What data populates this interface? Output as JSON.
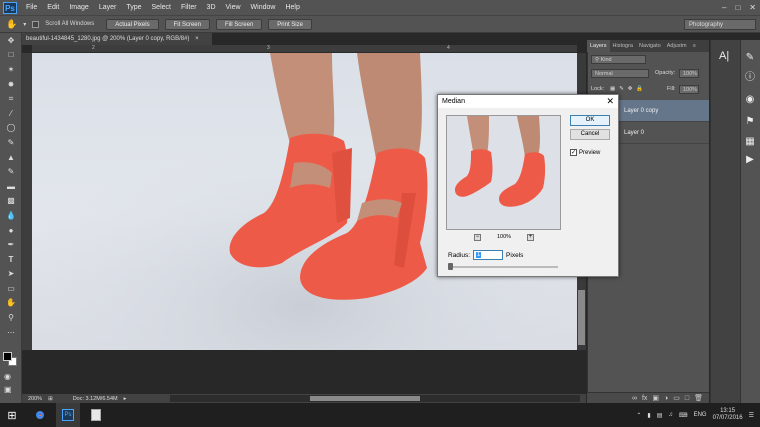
{
  "menubar": {
    "logo": "Ps",
    "items": [
      "File",
      "Edit",
      "Image",
      "Layer",
      "Type",
      "Select",
      "Filter",
      "3D",
      "View",
      "Window",
      "Help"
    ]
  },
  "options": {
    "scroll_all_label": "Scroll All Windows",
    "buttons": [
      "Actual Pixels",
      "Fit Screen",
      "Fill Screen",
      "Print Size"
    ],
    "workspace": "Photography"
  },
  "document": {
    "tab_title": "beautiful-1434845_1280.jpg @ 200% (Layer 0 copy, RGB/8#)",
    "ruler_marks": [
      "0",
      "2",
      "3",
      "4"
    ],
    "zoom": "200%",
    "doc_size": "Doc: 3.12M/6.54M"
  },
  "panels": {
    "tabs": [
      "Layers",
      "Histogra",
      "Navigato",
      "Adjustm"
    ],
    "kind_label": "Kind",
    "blend_mode": "Normal",
    "opacity_label": "Opacity:",
    "opacity_value": "100%",
    "lock_label": "Lock:",
    "fill_label": "Fill:",
    "fill_value": "100%",
    "layers": [
      {
        "name": "Layer 0 copy",
        "selected": true
      },
      {
        "name": "Layer 0",
        "selected": false
      }
    ]
  },
  "dialog": {
    "title": "Median",
    "ok_label": "OK",
    "cancel_label": "Cancel",
    "preview_label": "Preview",
    "preview_checked": true,
    "zoom_value": "100%",
    "radius_label": "Radius:",
    "radius_value": "1",
    "radius_unit": "Pixels"
  },
  "taskbar": {
    "language": "ENG",
    "time": "13:15",
    "date": "07/07/2016"
  },
  "colors": {
    "shoe": "#ee5a48",
    "skin": "#c48f78",
    "accent": "#3399ff"
  }
}
